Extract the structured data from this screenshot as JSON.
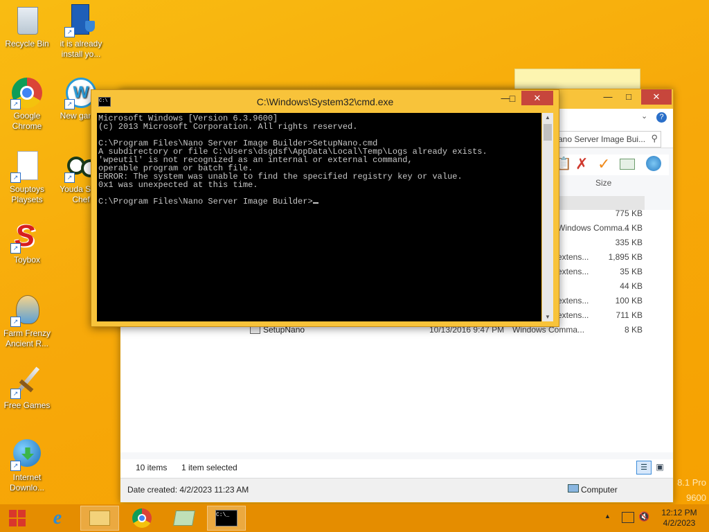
{
  "desktop": {
    "icons": [
      {
        "label": "Recycle Bin",
        "icon": "recycle-bin-icon"
      },
      {
        "label": "it is already install yo...",
        "icon": "shortcut-icon"
      },
      {
        "label": "Google Chrome",
        "icon": "chrome-icon"
      },
      {
        "label": "New gam...",
        "icon": "new-games-icon"
      },
      {
        "label": "Souptoys Playsets",
        "icon": "document-icon"
      },
      {
        "label": "Youda Su... Chef",
        "icon": "sushi-icon"
      },
      {
        "label": "Toybox",
        "icon": "toybox-icon"
      },
      {
        "label": "Farm Frenzy Ancient R...",
        "icon": "farm-frenzy-icon"
      },
      {
        "label": "Free Games",
        "icon": "sword-icon"
      },
      {
        "label": "Internet Downlo...",
        "icon": "idm-icon"
      }
    ],
    "watermark": [
      "8.1 Pro",
      "9600"
    ]
  },
  "cmd": {
    "title": "C:\\Windows\\System32\\cmd.exe",
    "lines": [
      "Microsoft Windows [Version 6.3.9600]",
      "(c) 2013 Microsoft Corporation. All rights reserved.",
      "",
      "C:\\Program Files\\Nano Server Image Builder>SetupNano.cmd",
      "A subdirectory or file C:\\Users\\dsgdsf\\AppData\\Local\\Temp\\Logs already exists.",
      "'wpeutil' is not recognized as an internal or external command,",
      "operable program or batch file.",
      "ERROR: The system was unable to find the specified registry key or value.",
      "0x1 was unexpected at this time.",
      "",
      "C:\\Program Files\\Nano Server Image Builder>"
    ]
  },
  "explorer": {
    "search_text": "ano Server Image Bui...",
    "size_header": "Size",
    "rows": [
      {
        "type": "",
        "size": "775 KB"
      },
      {
        "type": "Windows Comma...",
        "size": "4 KB"
      },
      {
        "type": "",
        "size": "335 KB"
      },
      {
        "type": "extens...",
        "size": "1,895 KB"
      },
      {
        "type": "extens...",
        "size": "35 KB"
      },
      {
        "type": "",
        "size": "44 KB"
      },
      {
        "type": "extens...",
        "size": "100 KB"
      },
      {
        "type": "extens...",
        "size": "711 KB"
      }
    ],
    "visible_row": {
      "name": "SetupNano",
      "date": "10/13/2016 9:47 PM",
      "type": "Windows Comma...",
      "size": "8 KB"
    },
    "status": {
      "items": "10 items",
      "selected": "1 item selected"
    },
    "details": {
      "date_created": "Date created: 4/2/2023 11:23 AM",
      "computer": "Computer"
    }
  },
  "taskbar": {
    "time": "12:12 PM",
    "date": "4/2/2023"
  }
}
